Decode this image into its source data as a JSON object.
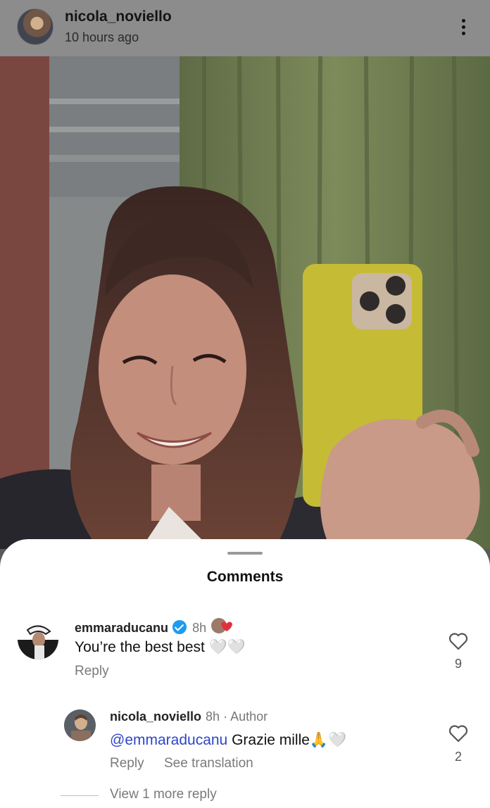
{
  "header": {
    "username": "nicola_noviello",
    "time": "10 hours ago"
  },
  "sheet": {
    "title": "Comments"
  },
  "comments": [
    {
      "username": "emmaraducanu",
      "verified": true,
      "time": "8h",
      "text": "You’re the best best 🤍🤍",
      "reply_label": "Reply",
      "likes": "9"
    },
    {
      "username": "nicola_noviello",
      "time": "8h",
      "author_tag": "· Author",
      "mention": "@emmaraducanu",
      "text": " Grazie mille🙏🤍",
      "reply_label": "Reply",
      "translate_label": "See translation",
      "likes": "2"
    }
  ],
  "view_more": "View 1 more reply"
}
